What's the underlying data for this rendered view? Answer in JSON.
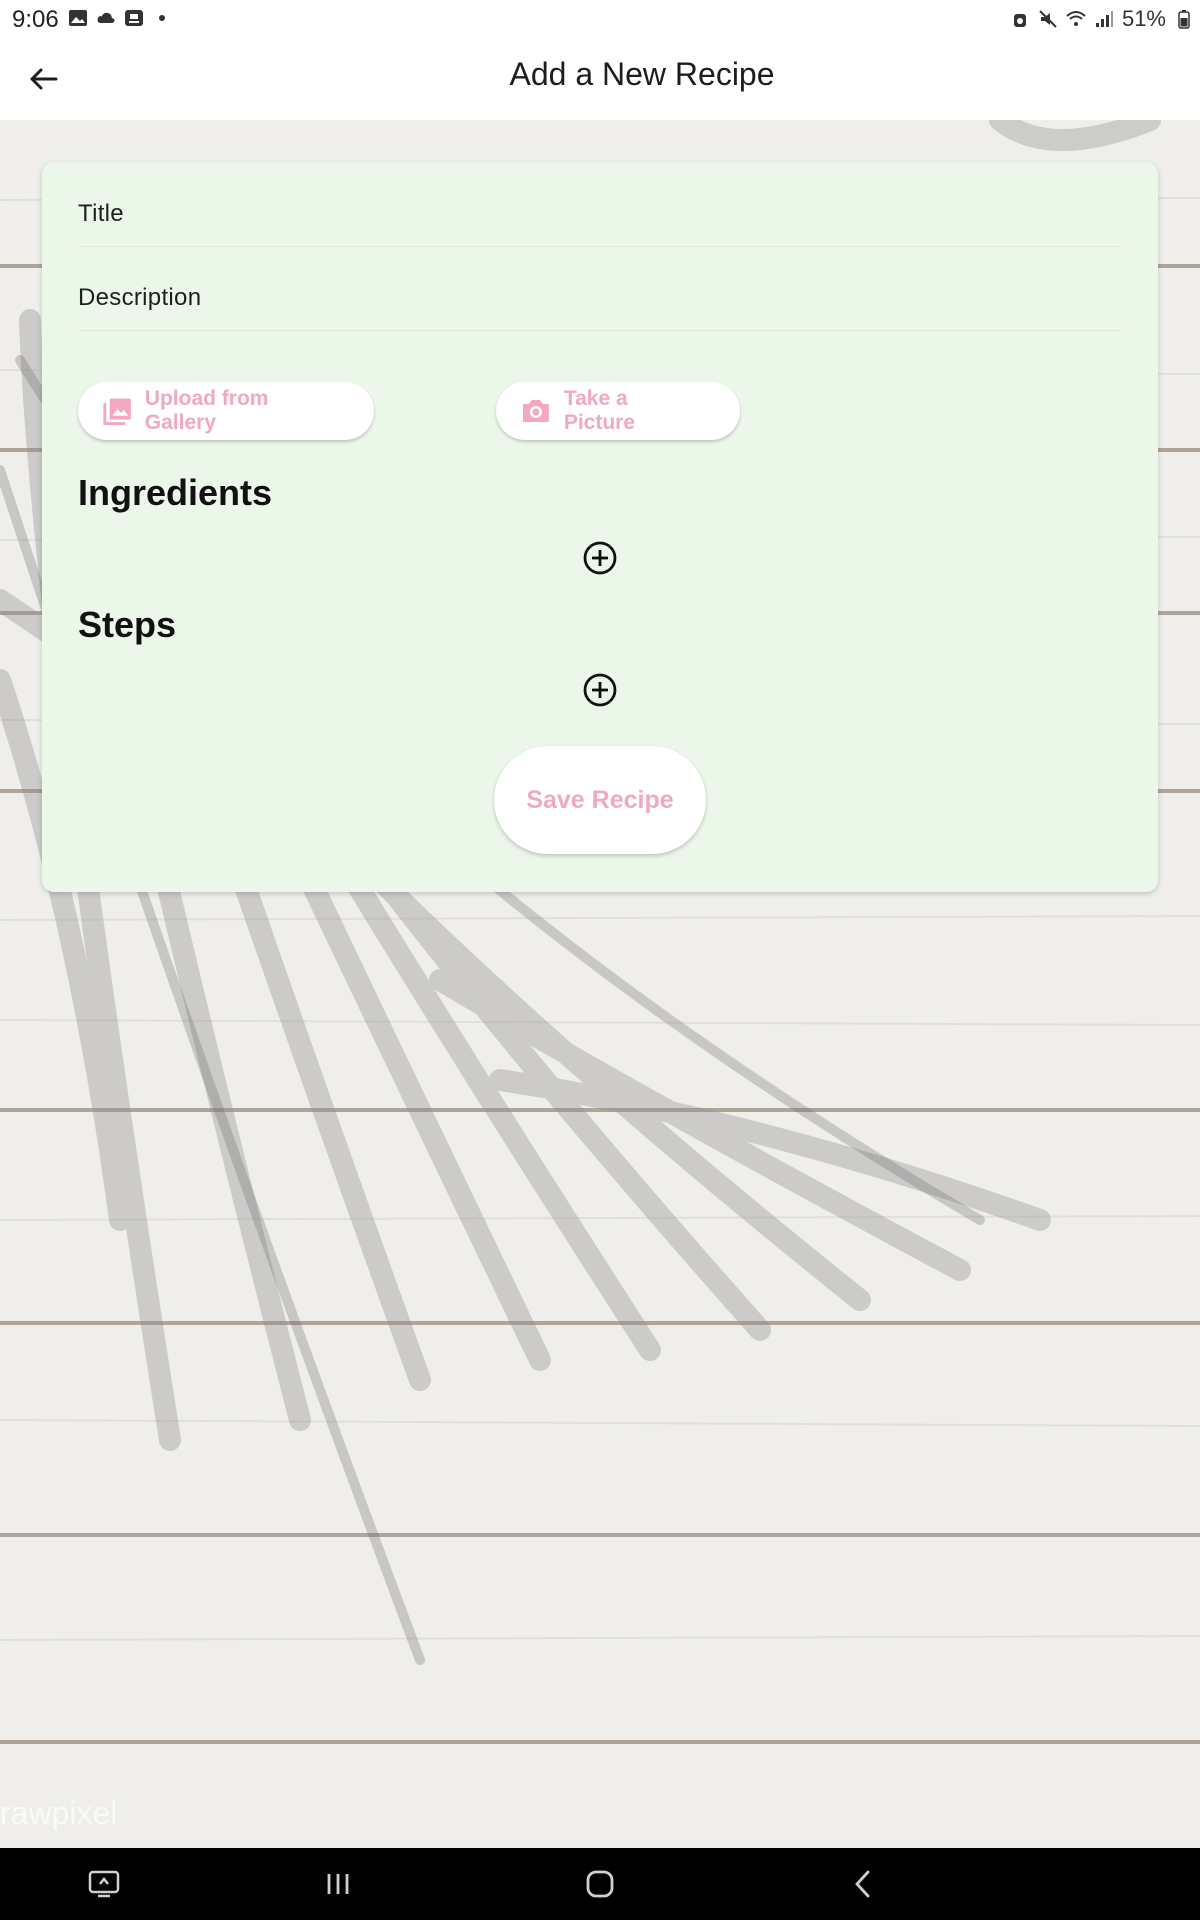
{
  "status_bar": {
    "time": "9:06",
    "battery": "51%",
    "left_icons": [
      "image-icon",
      "cloud-icon",
      "screen-share-icon",
      "dot-icon"
    ],
    "right_icons": [
      "alarm-icon",
      "mute-icon",
      "wifi-icon",
      "signal-icon",
      "battery-icon"
    ]
  },
  "app_bar": {
    "title": "Add a New Recipe",
    "back_icon": "arrow-back-icon"
  },
  "form": {
    "title_label": "Title",
    "description_label": "Description",
    "upload_label": "Upload from Gallery",
    "camera_label": "Take a Picture",
    "ingredients_heading": "Ingredients",
    "steps_heading": "Steps",
    "save_label": "Save Recipe"
  },
  "background": {
    "watermark": "rawpixel"
  },
  "colors": {
    "card_bg": "#ebf8e9",
    "accent_pink": "#f2a7c3",
    "app_bar_bg": "#ffffff",
    "nav_bar_bg": "#000000"
  },
  "nav_bar": {
    "items": [
      "recent-apps-icon",
      "menu-lines-icon",
      "home-icon",
      "back-chevron-icon"
    ]
  }
}
